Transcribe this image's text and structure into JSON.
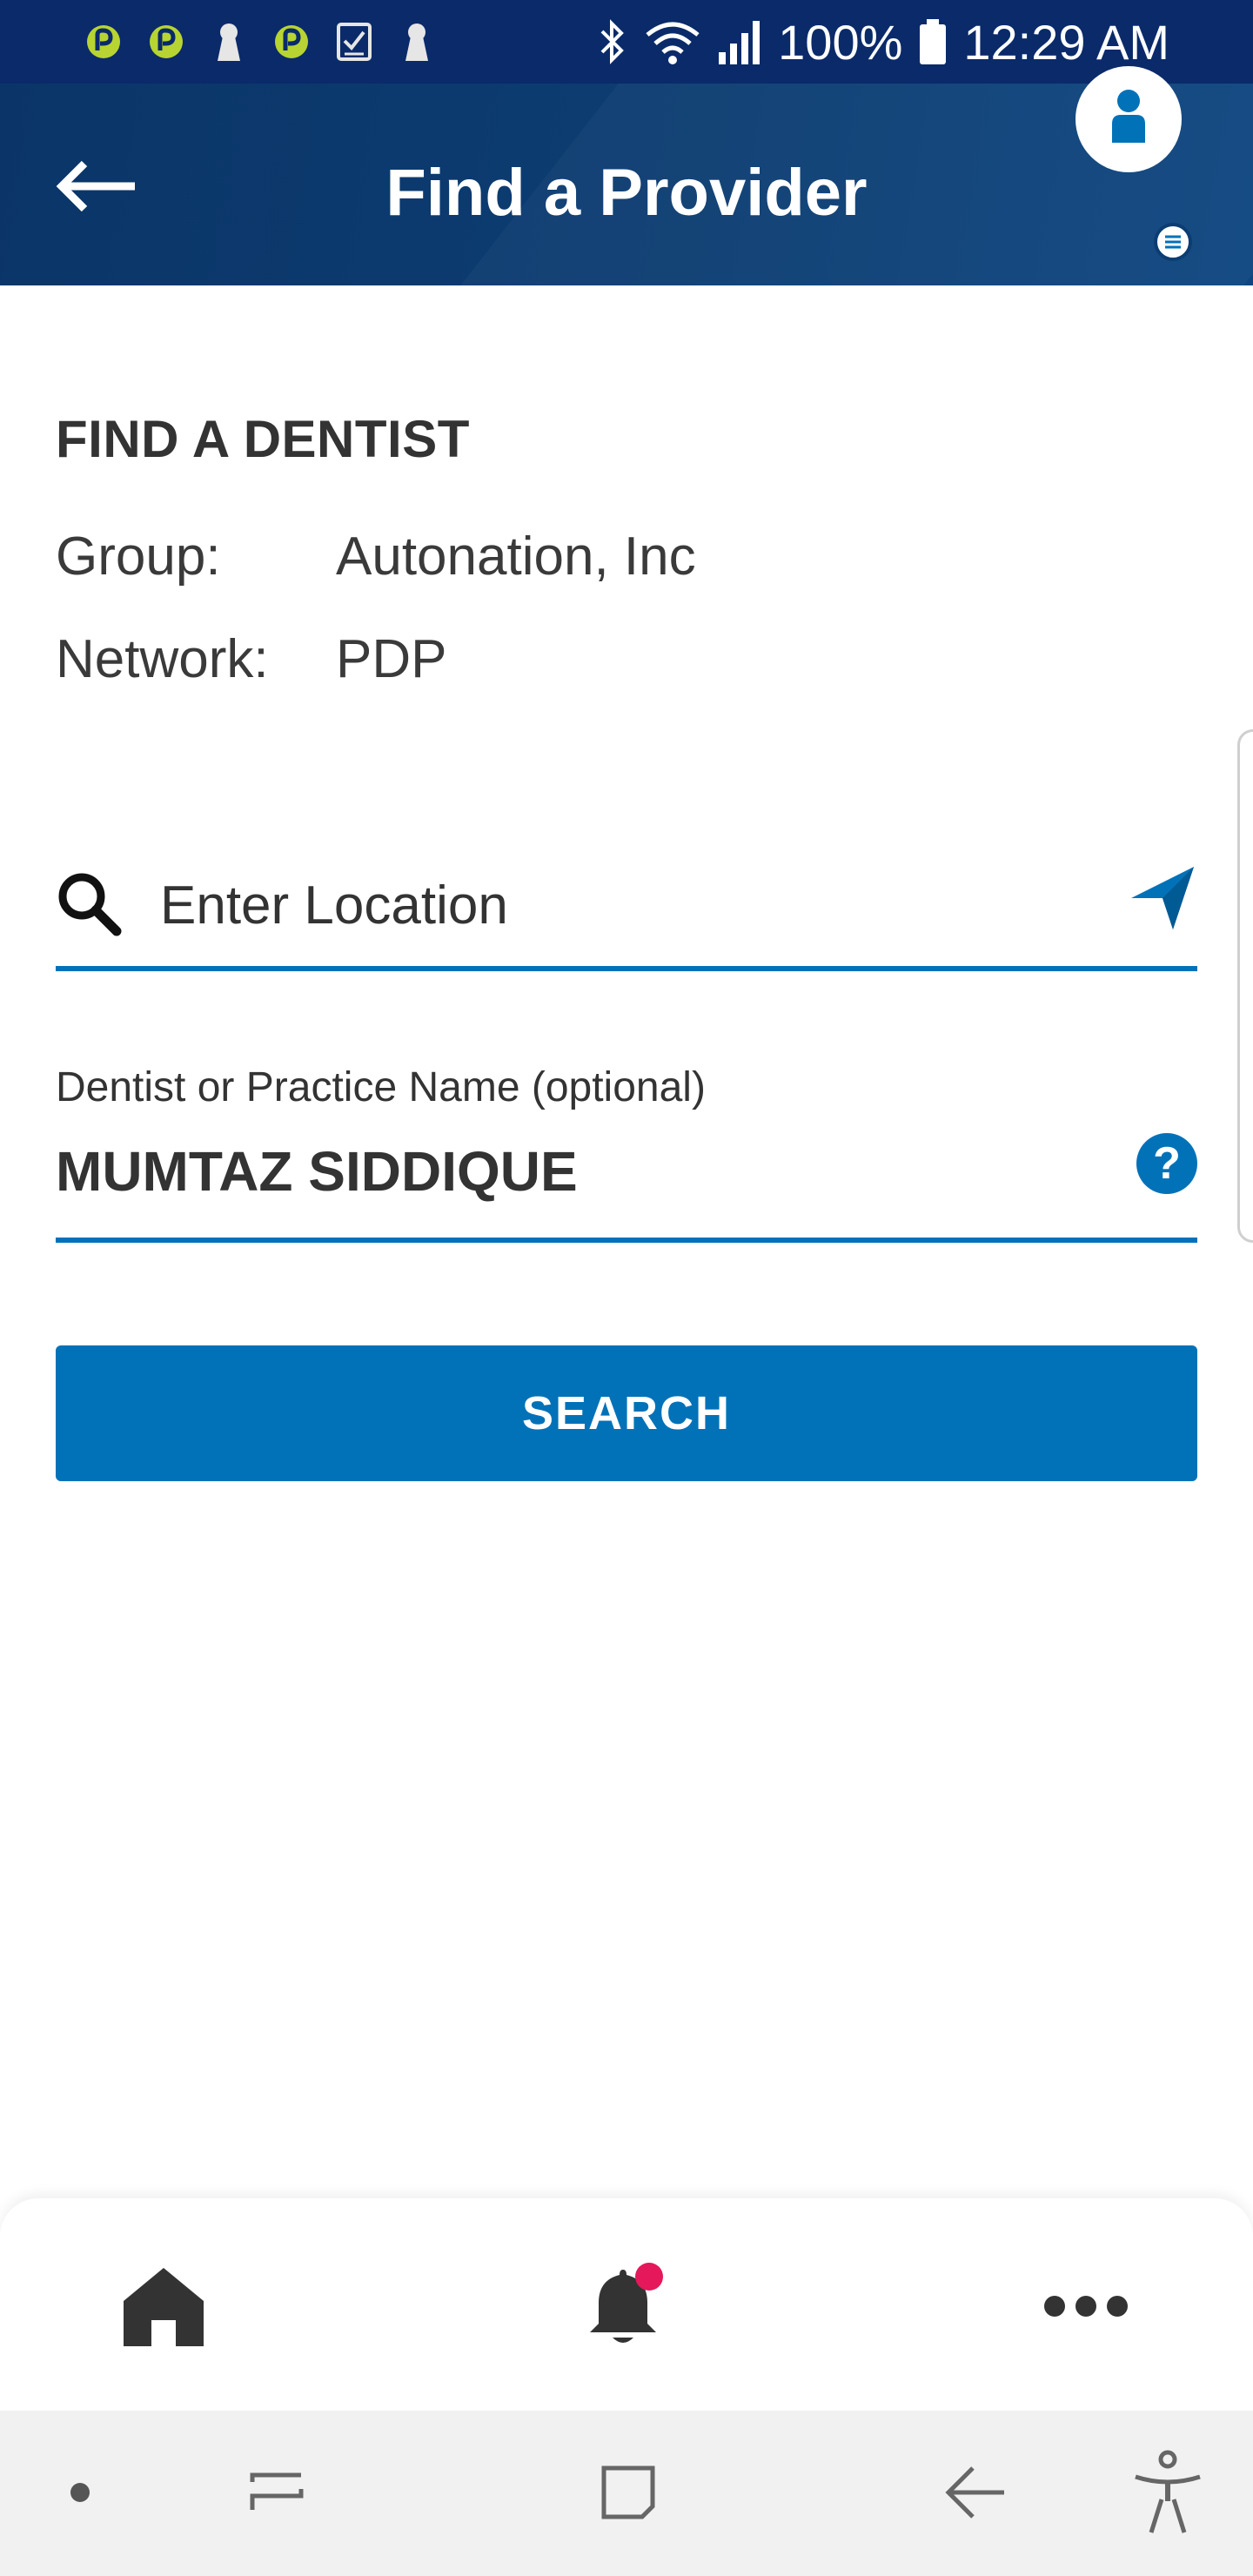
{
  "status_bar": {
    "battery": "100%",
    "time": "12:29 AM",
    "left_icons": [
      "app-notification-icon",
      "app-notification-icon",
      "keyhole-icon",
      "app-notification-icon",
      "checklist-icon",
      "keyhole-icon"
    ],
    "right_icons": [
      "bluetooth-icon",
      "wifi-icon",
      "signal-icon",
      "battery-icon"
    ]
  },
  "header": {
    "title": "Find a Provider",
    "back_icon": "arrow-left-icon",
    "profile_icon": "user-profile-icon",
    "colors": {
      "background": "#0c3d72",
      "accent": "#0272b8"
    }
  },
  "find_dentist": {
    "section_title": "FIND A DENTIST",
    "group_label": "Group:",
    "group_value": "Autonation, Inc",
    "network_label": "Network:",
    "network_value": "PDP"
  },
  "location": {
    "placeholder": "Enter Location",
    "value": "",
    "icon": "search-icon",
    "locate_icon": "location-arrow-icon"
  },
  "dentist": {
    "label": "Dentist or Practice Name (optional)",
    "value": "MUMTAZ SIDDIQUE",
    "help_glyph": "?"
  },
  "search_button": {
    "label": "SEARCH"
  },
  "bottom_nav": {
    "items": [
      {
        "icon": "home-icon"
      },
      {
        "icon": "bell-icon",
        "badge_color": "#e4185a"
      },
      {
        "icon": "more-icon"
      }
    ]
  },
  "system_nav": {
    "items": [
      "dot-icon",
      "recent-apps-icon",
      "home-square-icon",
      "back-icon",
      "accessibility-icon"
    ]
  }
}
